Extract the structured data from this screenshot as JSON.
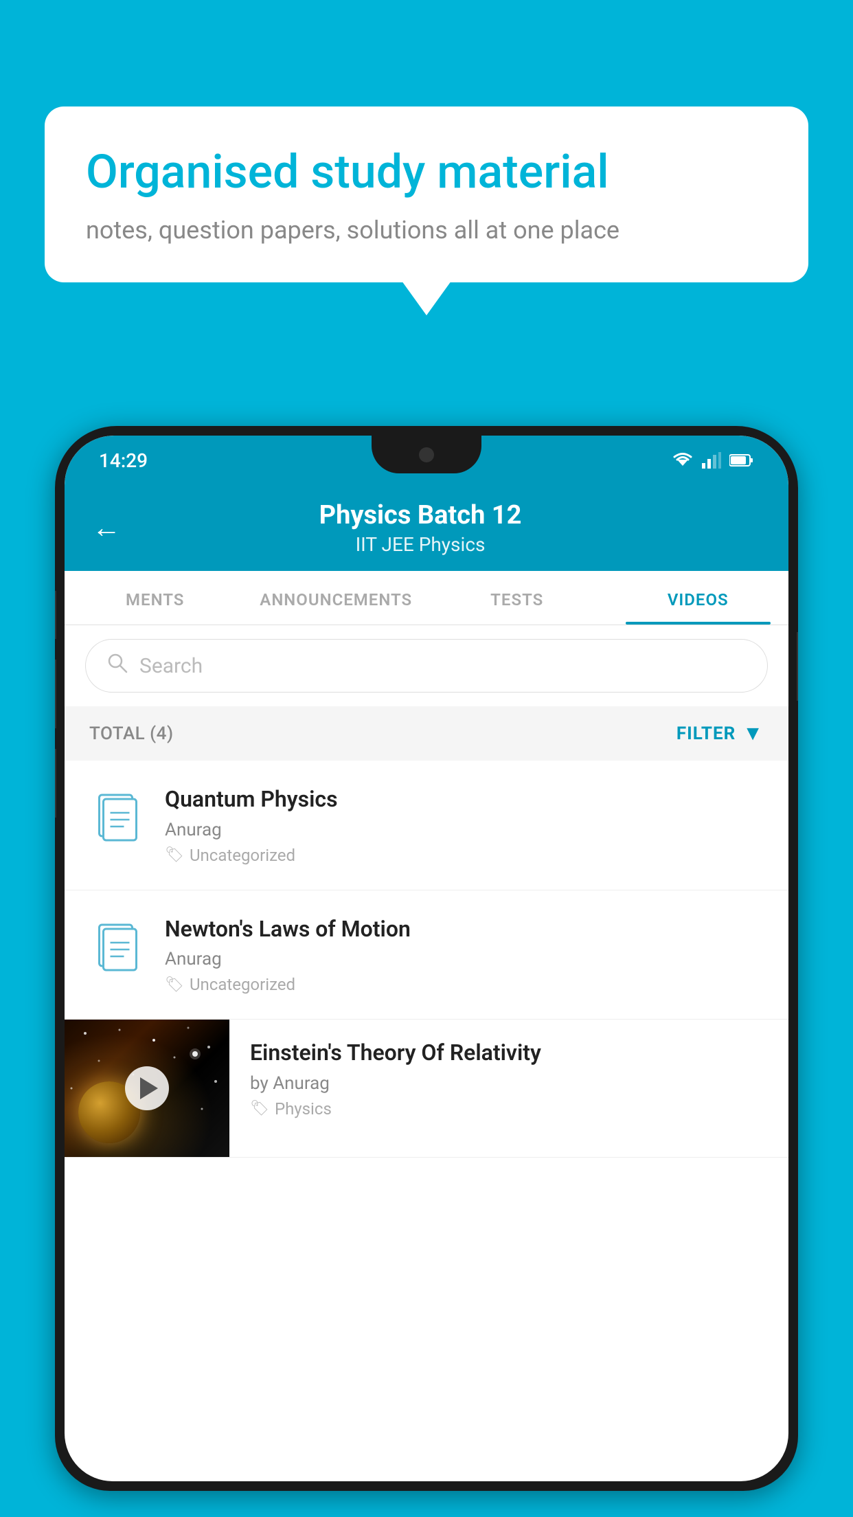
{
  "bubble": {
    "title": "Organised study material",
    "subtitle": "notes, question papers, solutions all at one place"
  },
  "status_bar": {
    "time": "14:29"
  },
  "header": {
    "back_label": "←",
    "title": "Physics Batch 12",
    "tags": "IIT JEE   Physics"
  },
  "tabs": [
    {
      "label": "MENTS",
      "active": false
    },
    {
      "label": "ANNOUNCEMENTS",
      "active": false
    },
    {
      "label": "TESTS",
      "active": false
    },
    {
      "label": "VIDEOS",
      "active": true
    }
  ],
  "search": {
    "placeholder": "Search"
  },
  "total_bar": {
    "label": "TOTAL (4)",
    "filter_label": "FILTER"
  },
  "videos": [
    {
      "title": "Quantum Physics",
      "author": "Anurag",
      "tag": "Uncategorized",
      "has_thumb": false
    },
    {
      "title": "Newton's Laws of Motion",
      "author": "Anurag",
      "tag": "Uncategorized",
      "has_thumb": false
    },
    {
      "title": "Einstein's Theory Of Relativity",
      "author": "by Anurag",
      "tag": "Physics",
      "has_thumb": true
    }
  ]
}
